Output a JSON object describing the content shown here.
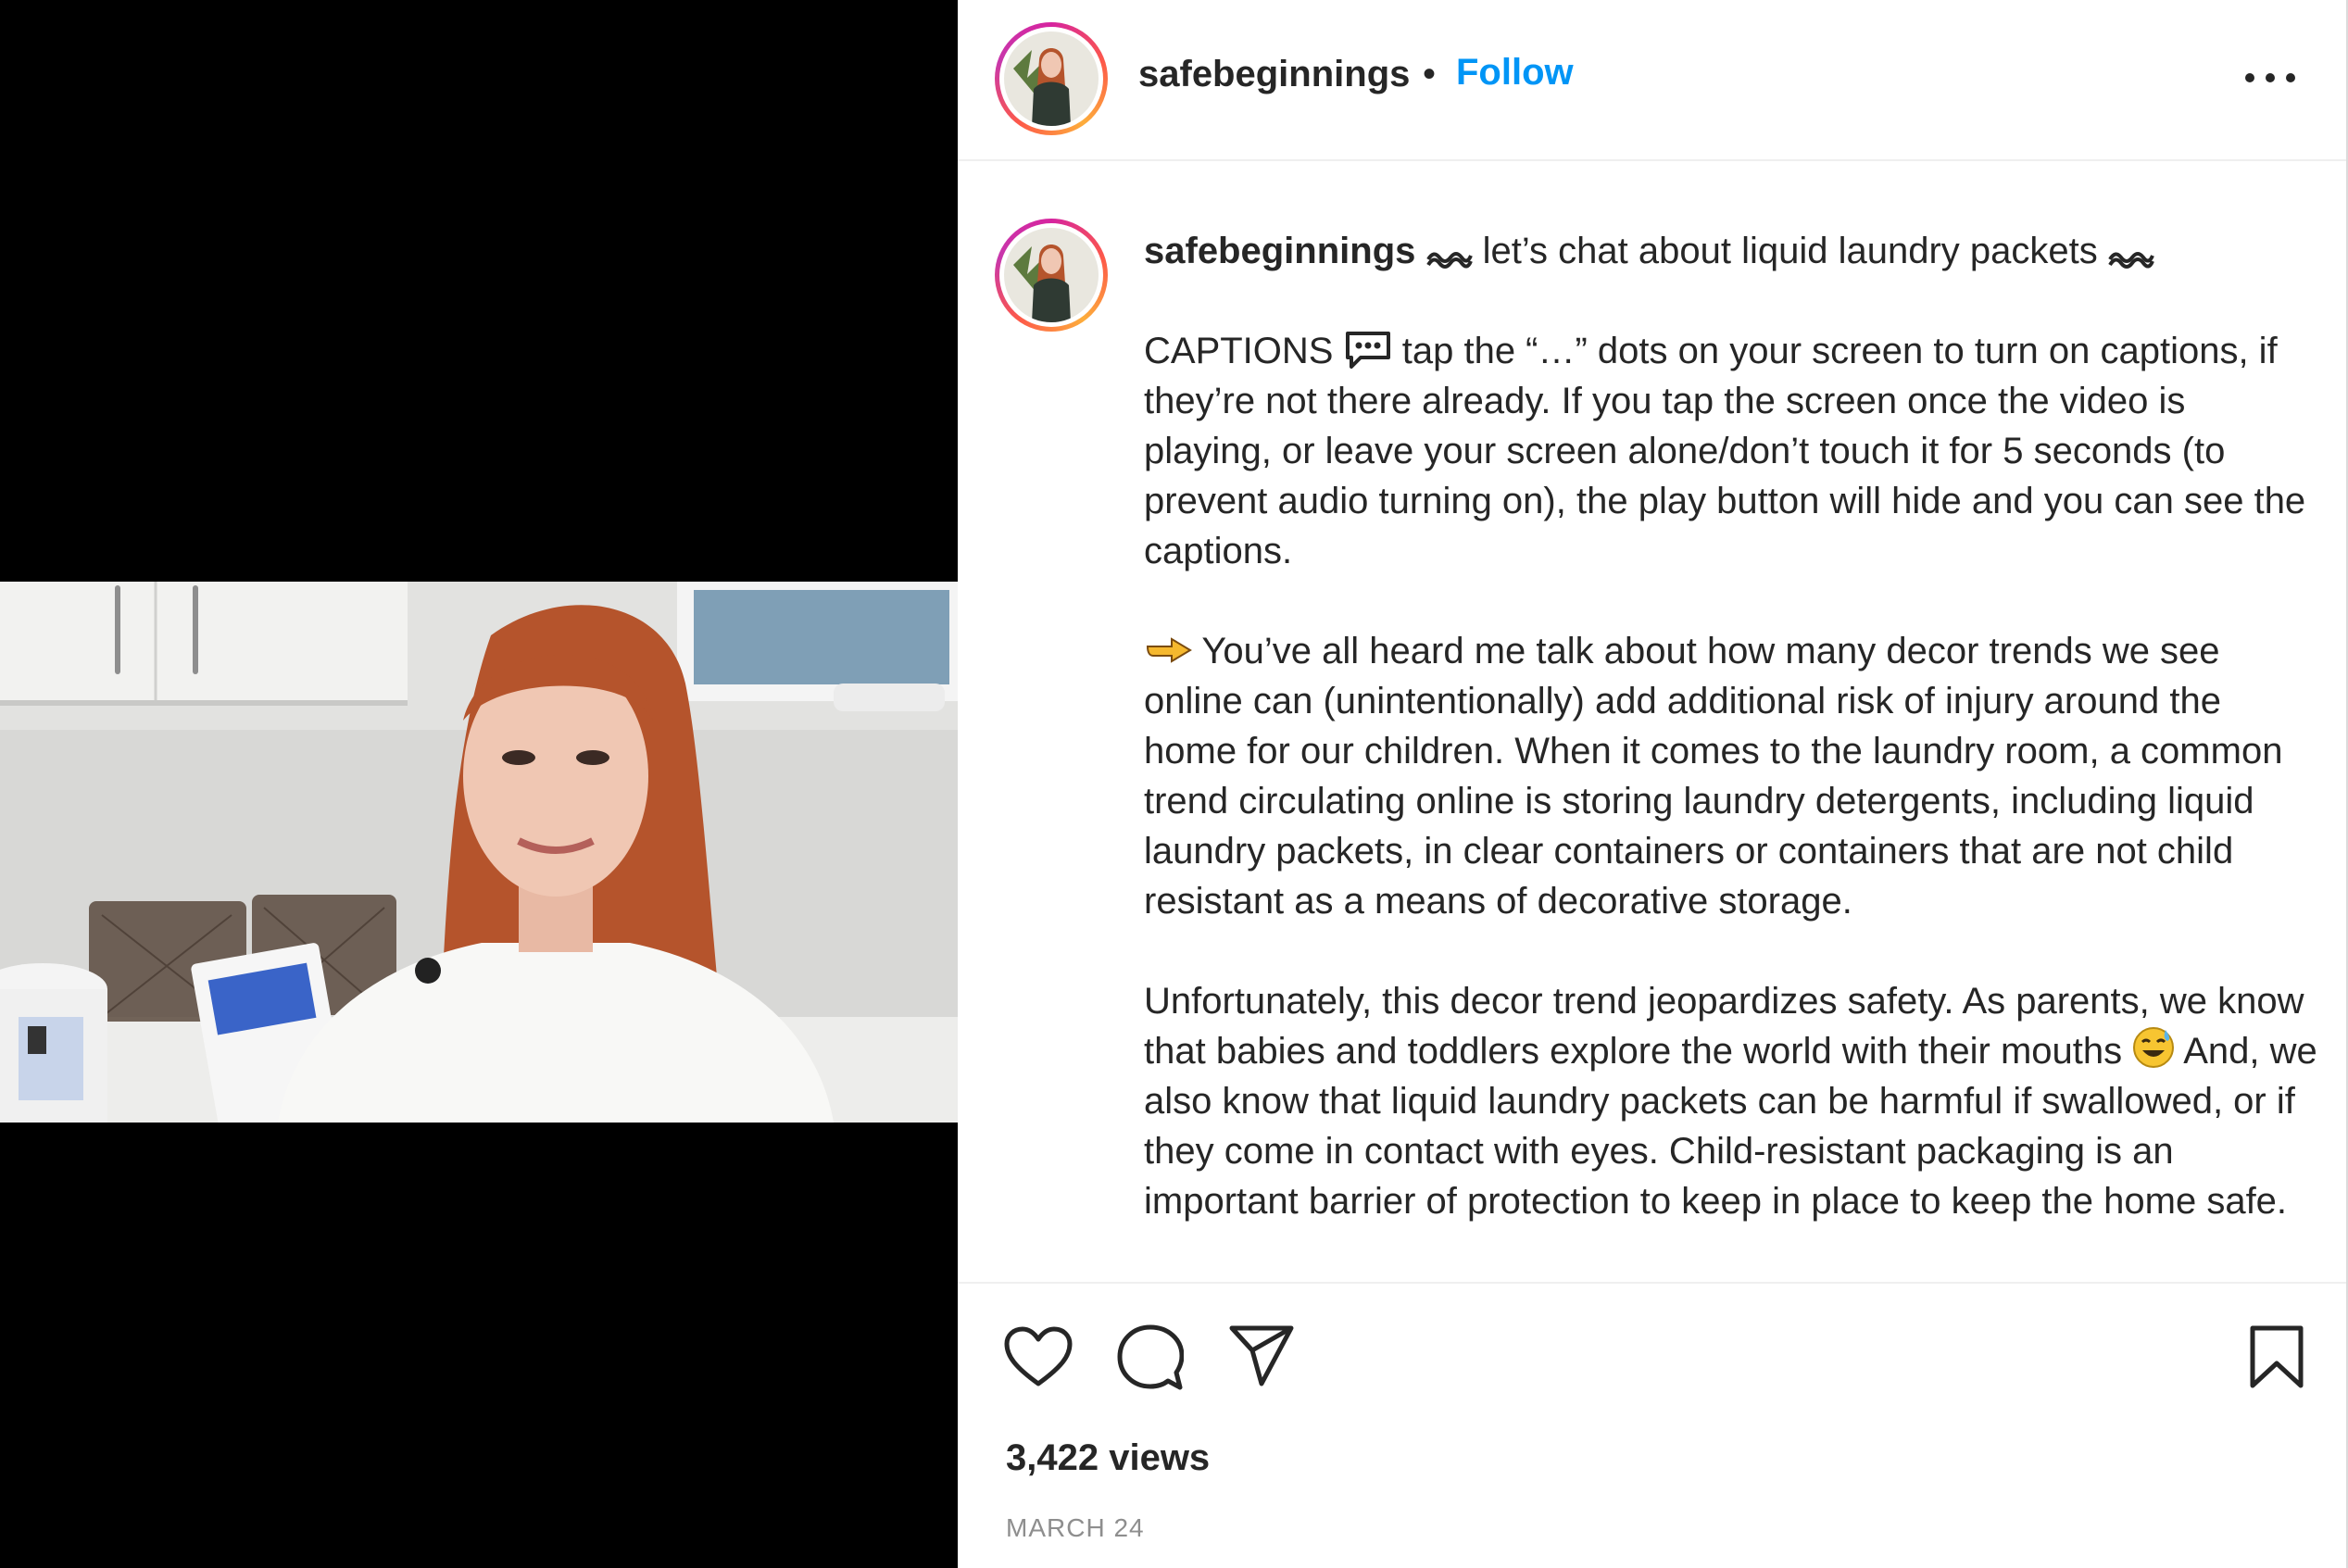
{
  "header": {
    "username": "safebeginnings",
    "separator": "•",
    "follow_label": "Follow",
    "more_icon": "more-options-icon"
  },
  "caption": {
    "username": "safebeginnings",
    "headline": "let’s chat about liquid laundry packets",
    "para1_lead": "CAPTIONS",
    "para1_text": "tap the “…” dots on your screen to turn on captions, if they’re not there already. If you tap the screen once the video is playing, or leave your screen alone/don’t touch it for 5 seconds (to prevent audio turning on), the play button will hide and you can see the captions.",
    "para2_text": "You’ve all heard me talk about how many decor trends we see online can (unintentionally) add additional risk of injury around the home for our children. When it comes to the laundry room, a common trend circulating online is storing laundry detergents, including liquid laundry packets, in clear containers or containers that are not child resistant as a means of decorative storage.",
    "para3_text_a": "Unfortunately, this decor trend jeopardizes safety. As parents, we know that babies and toddlers explore the world with their mouths",
    "para3_text_b": "And, we also know that liquid laundry packets can be harmful if swallowed, or if they come in contact with eyes. Child-resistant packaging is an important barrier of protection to keep in place to keep the home safe."
  },
  "actions": {
    "like_icon": "heart-icon",
    "comment_icon": "comment-icon",
    "share_icon": "share-icon",
    "save_icon": "bookmark-icon",
    "views": "3,422 views",
    "date": "MARCH 24"
  },
  "colors": {
    "link": "#0095f6",
    "text": "#262626",
    "muted": "#8e8e8e",
    "media_bg": "#000000"
  }
}
